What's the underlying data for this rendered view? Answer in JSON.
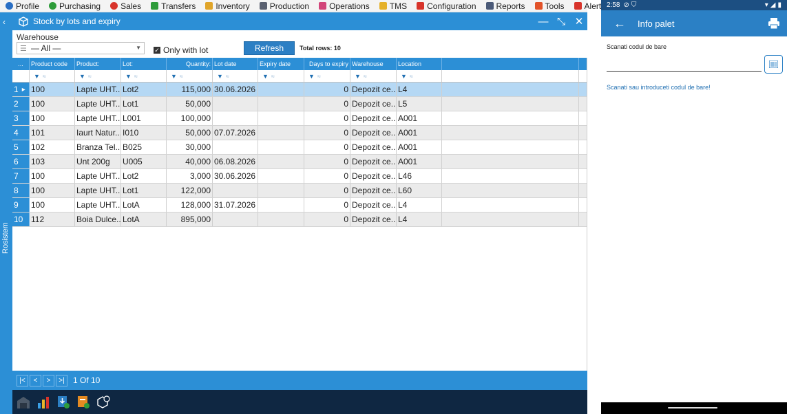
{
  "menubar": {
    "items": [
      {
        "label": "Profile",
        "icon": "profile-icon",
        "color": "#2a6fc4"
      },
      {
        "label": "Purchasing",
        "icon": "plus-circle-icon",
        "color": "#2e9c3a"
      },
      {
        "label": "Sales",
        "icon": "minus-circle-icon",
        "color": "#d8342b"
      },
      {
        "label": "Transfers",
        "icon": "transfers-icon",
        "color": "#2e9c3a"
      },
      {
        "label": "Inventory",
        "icon": "inventory-icon",
        "color": "#e0a52a"
      },
      {
        "label": "Production",
        "icon": "production-icon",
        "color": "#5a6070"
      },
      {
        "label": "Operations",
        "icon": "operations-icon",
        "color": "#d2457a"
      },
      {
        "label": "TMS",
        "icon": "tms-icon",
        "color": "#e5b12a"
      },
      {
        "label": "Configuration",
        "icon": "configuration-icon",
        "color": "#d8342b"
      },
      {
        "label": "Reports",
        "icon": "reports-icon",
        "color": "#4b5a78"
      },
      {
        "label": "Tools",
        "icon": "gear-icon",
        "color": "#e2532a"
      },
      {
        "label": "Alerts",
        "icon": "bell-icon",
        "color": "#d8342b"
      }
    ]
  },
  "rail": {
    "label": "Rosistem"
  },
  "window": {
    "title": "Stock by lots and expiry"
  },
  "filters": {
    "warehouse_label": "Warehouse",
    "warehouse_value": "— All —",
    "only_with_lot_label": "Only with lot",
    "refresh_label": "Refresh",
    "total_rows": "Total rows: 10"
  },
  "grid": {
    "header_idx": "...",
    "columns": [
      "Product code",
      "Product:",
      "Lot:",
      "Quantity:",
      "Lot date",
      "Expiry date",
      "Days to expiry",
      "Warehouse",
      "Location"
    ],
    "rows": [
      {
        "idx": "1",
        "code": "100",
        "product": "Lapte UHT...",
        "lot": "Lot2",
        "qty": "115,000",
        "lot_date": "30.06.2026",
        "expiry": "",
        "days": "0",
        "warehouse": "Depozit ce...",
        "location": "L4"
      },
      {
        "idx": "2",
        "code": "100",
        "product": "Lapte UHT...",
        "lot": "Lot1",
        "qty": "50,000",
        "lot_date": "",
        "expiry": "",
        "days": "0",
        "warehouse": "Depozit ce...",
        "location": "L5"
      },
      {
        "idx": "3",
        "code": "100",
        "product": "Lapte UHT...",
        "lot": "L001",
        "qty": "100,000",
        "lot_date": "",
        "expiry": "",
        "days": "0",
        "warehouse": "Depozit ce...",
        "location": "A001"
      },
      {
        "idx": "4",
        "code": "101",
        "product": "Iaurt Natur...",
        "lot": "I010",
        "qty": "50,000",
        "lot_date": "07.07.2026",
        "expiry": "",
        "days": "0",
        "warehouse": "Depozit ce...",
        "location": "A001"
      },
      {
        "idx": "5",
        "code": "102",
        "product": "Branza Tel...",
        "lot": "B025",
        "qty": "30,000",
        "lot_date": "",
        "expiry": "",
        "days": "0",
        "warehouse": "Depozit ce...",
        "location": "A001"
      },
      {
        "idx": "6",
        "code": "103",
        "product": "Unt 200g",
        "lot": "U005",
        "qty": "40,000",
        "lot_date": "06.08.2026",
        "expiry": "",
        "days": "0",
        "warehouse": "Depozit ce...",
        "location": "A001"
      },
      {
        "idx": "7",
        "code": "100",
        "product": "Lapte UHT...",
        "lot": "Lot2",
        "qty": "3,000",
        "lot_date": "30.06.2026",
        "expiry": "",
        "days": "0",
        "warehouse": "Depozit ce...",
        "location": "L46"
      },
      {
        "idx": "8",
        "code": "100",
        "product": "Lapte UHT...",
        "lot": "Lot1",
        "qty": "122,000",
        "lot_date": "",
        "expiry": "",
        "days": "0",
        "warehouse": "Depozit ce...",
        "location": "L60"
      },
      {
        "idx": "9",
        "code": "100",
        "product": "Lapte UHT...",
        "lot": "LotA",
        "qty": "128,000",
        "lot_date": "31.07.2026",
        "expiry": "",
        "days": "0",
        "warehouse": "Depozit ce...",
        "location": "L4"
      },
      {
        "idx": "10",
        "code": "112",
        "product": "Boia Dulce...",
        "lot": "LotA",
        "qty": "895,000",
        "lot_date": "",
        "expiry": "",
        "days": "0",
        "warehouse": "Depozit ce...",
        "location": "L4"
      }
    ]
  },
  "pager": {
    "first": "|<",
    "prev": "<",
    "next": ">",
    "last": ">|",
    "info": "1 Of 10"
  },
  "mobile": {
    "status_time": "2:58",
    "title": "Info palet",
    "scan_label": "Scanati codul de bare",
    "scan_link": "Scanati sau introduceti codul de bare!"
  },
  "colors": {
    "accent": "#2c8fd6",
    "selected_row": "#b5d8f4",
    "taskbar": "#0f2742"
  }
}
